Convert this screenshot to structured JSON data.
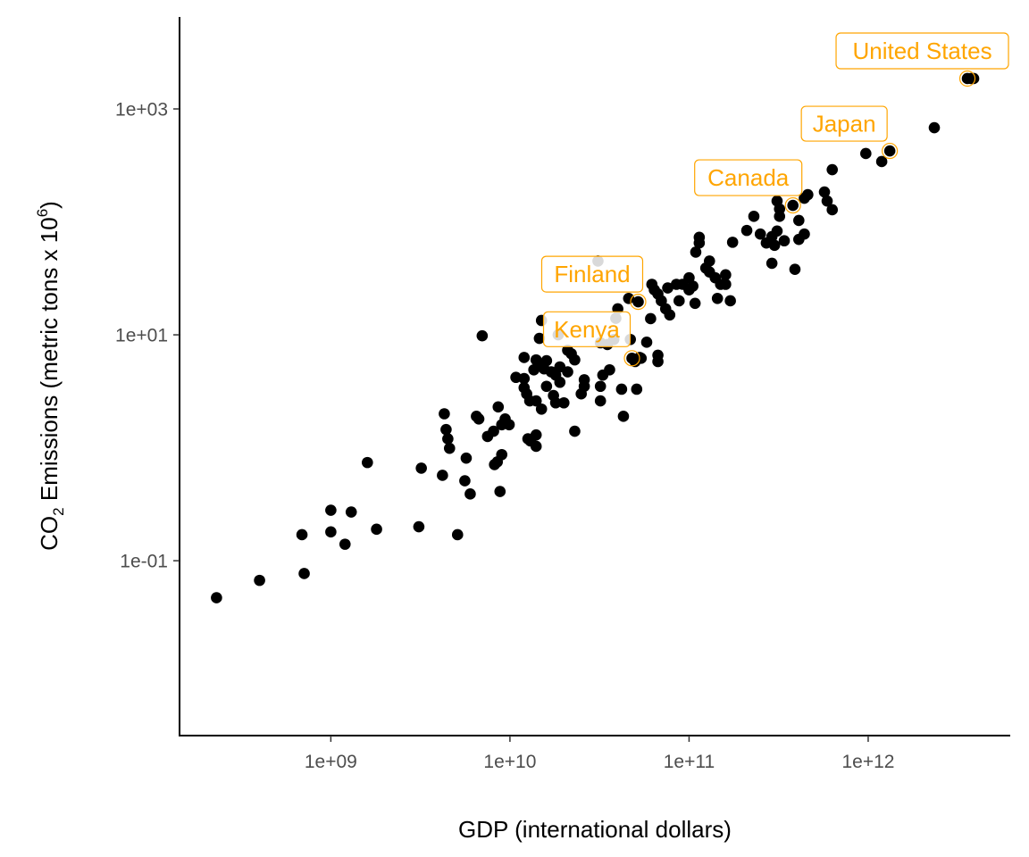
{
  "chart_data": {
    "type": "scatter",
    "title": "",
    "xlabel": "GDP (international dollars)",
    "ylabel": {
      "prefix": "CO",
      "subscript": "2",
      "middle": " Emissions (metric tons x 10",
      "superscript": "6",
      "suffix": ")"
    },
    "x_scale": "log10",
    "y_scale": "log10",
    "xlim": [
      143000000.0,
      6210000000000.0
    ],
    "ylim": [
      0.00283,
      6520
    ],
    "x_ticks": [
      {
        "value": 1000000000.0,
        "label": "1e+09"
      },
      {
        "value": 10000000000.0,
        "label": "1e+10"
      },
      {
        "value": 100000000000.0,
        "label": "1e+11"
      },
      {
        "value": 1000000000000.0,
        "label": "1e+12"
      }
    ],
    "y_ticks": [
      {
        "value": 0.1,
        "label": "1e-01"
      },
      {
        "value": 10,
        "label": "1e+01"
      },
      {
        "value": 1000,
        "label": "1e+03"
      }
    ],
    "grid": false,
    "legend": "none",
    "point_color": "#000000",
    "highlight_color": "#FFA500",
    "points": [
      [
        230000000.0,
        0.047
      ],
      [
        400000000.0,
        0.067
      ],
      [
        690000000.0,
        0.17
      ],
      [
        710000000.0,
        0.077
      ],
      [
        1000000000.0,
        0.28
      ],
      [
        1000000000.0,
        0.18
      ],
      [
        1300000000.0,
        0.27
      ],
      [
        1200000000.0,
        0.14
      ],
      [
        1600000000.0,
        0.74
      ],
      [
        1800000000.0,
        0.19
      ],
      [
        3100000000.0,
        0.2
      ],
      [
        3200000000.0,
        0.66
      ],
      [
        4200000000.0,
        0.57
      ],
      [
        4300000000.0,
        2.0
      ],
      [
        4400000000.0,
        1.45
      ],
      [
        4500000000.0,
        1.2
      ],
      [
        4600000000.0,
        0.99
      ],
      [
        5100000000.0,
        0.17
      ],
      [
        5600000000.0,
        0.51
      ],
      [
        6000000000.0,
        0.39
      ],
      [
        5700000000.0,
        0.81
      ],
      [
        6500000000.0,
        1.9
      ],
      [
        6700000000.0,
        1.8
      ],
      [
        7000000000.0,
        9.8
      ],
      [
        7500000000.0,
        1.26
      ],
      [
        8100000000.0,
        1.4
      ],
      [
        8200000000.0,
        0.71
      ],
      [
        8500000000.0,
        0.75
      ],
      [
        8800000000.0,
        0.41
      ],
      [
        8600000000.0,
        2.3
      ],
      [
        9000000000.0,
        1.6
      ],
      [
        9400000000.0,
        1.8
      ],
      [
        9900000000.0,
        1.6
      ],
      [
        9000000000.0,
        0.87
      ],
      [
        10800000000.0,
        4.2
      ],
      [
        12000000000.0,
        6.3
      ],
      [
        12000000000.0,
        4.1
      ],
      [
        12000000000.0,
        3.4
      ],
      [
        12400000000.0,
        3.0
      ],
      [
        12900000000.0,
        2.6
      ],
      [
        12600000000.0,
        1.2
      ],
      [
        13000000000.0,
        1.15
      ],
      [
        14000000000.0,
        1.03
      ],
      [
        14000000000.0,
        1.3
      ],
      [
        14000000000.0,
        2.6
      ],
      [
        15000000000.0,
        2.2
      ],
      [
        13600000000.0,
        4.9
      ],
      [
        14000000000.0,
        6.0
      ],
      [
        14600000000.0,
        5.3
      ],
      [
        14600000000.0,
        9.3
      ],
      [
        15500000000.0,
        5.0
      ],
      [
        16000000000.0,
        5.9
      ],
      [
        15000000000.0,
        13.4
      ],
      [
        17000000000.0,
        4.7
      ],
      [
        16000000000.0,
        3.5
      ],
      [
        18000000000.0,
        4.4
      ],
      [
        19000000000.0,
        3.8
      ],
      [
        17500000000.0,
        2.9
      ],
      [
        18000000000.0,
        2.5
      ],
      [
        18600000000.0,
        10
      ],
      [
        20000000000.0,
        2.5
      ],
      [
        19000000000.0,
        5.2
      ],
      [
        21000000000.0,
        4.7
      ],
      [
        22000000000.0,
        6.8
      ],
      [
        23000000000.0,
        6.0
      ],
      [
        23000000000.0,
        1.4
      ],
      [
        25000000000.0,
        3.0
      ],
      [
        26000000000.0,
        3.5
      ],
      [
        26000000000.0,
        4.0
      ],
      [
        21000000000.0,
        7.3
      ],
      [
        31000000000.0,
        45
      ],
      [
        32000000000.0,
        8.5
      ],
      [
        32000000000.0,
        2.6
      ],
      [
        32000000000.0,
        3.5
      ],
      [
        33000000000.0,
        4.4
      ],
      [
        35000000000.0,
        8.2
      ],
      [
        36000000000.0,
        4.9
      ],
      [
        38000000000.0,
        9.1
      ],
      [
        40000000000.0,
        17
      ],
      [
        39000000000.0,
        14
      ],
      [
        42000000000.0,
        3.3
      ],
      [
        43000000000.0,
        1.9
      ],
      [
        47000000000.0,
        9.1
      ],
      [
        46000000000.0,
        21
      ],
      [
        50000000000.0,
        5.8
      ],
      [
        51000000000.0,
        3.3
      ],
      [
        53000000000.0,
        6.3
      ],
      [
        54000000000.0,
        6.2
      ],
      [
        58000000000.0,
        8.6
      ],
      [
        61000000000.0,
        13.9
      ],
      [
        62000000000.0,
        28
      ],
      [
        64000000000.0,
        25
      ],
      [
        67000000000.0,
        23
      ],
      [
        70000000000.0,
        20
      ],
      [
        74000000000.0,
        17
      ],
      [
        78000000000.0,
        15
      ],
      [
        67000000000.0,
        6.6
      ],
      [
        67000000000.0,
        5.8
      ],
      [
        76000000000.0,
        26
      ],
      [
        85000000000.0,
        28
      ],
      [
        92000000000.0,
        28
      ],
      [
        100000000000.0,
        32
      ],
      [
        100000000000.0,
        25
      ],
      [
        105000000000.0,
        27
      ],
      [
        108000000000.0,
        19
      ],
      [
        88000000000.0,
        20
      ],
      [
        114000000000.0,
        73
      ],
      [
        114000000000.0,
        65
      ],
      [
        109000000000.0,
        54
      ],
      [
        130000000000.0,
        45
      ],
      [
        124000000000.0,
        39
      ],
      [
        130000000000.0,
        36
      ],
      [
        140000000000.0,
        32
      ],
      [
        150000000000.0,
        28
      ],
      [
        160000000000.0,
        28
      ],
      [
        160000000000.0,
        34
      ],
      [
        144000000000.0,
        21
      ],
      [
        170000000000.0,
        20
      ],
      [
        175000000000.0,
        66
      ],
      [
        210000000000.0,
        84
      ],
      [
        230000000000.0,
        112
      ],
      [
        250000000000.0,
        78
      ],
      [
        270000000000.0,
        65
      ],
      [
        290000000000.0,
        74
      ],
      [
        310000000000.0,
        83
      ],
      [
        300000000000.0,
        62
      ],
      [
        290000000000.0,
        43
      ],
      [
        310000000000.0,
        153
      ],
      [
        320000000000.0,
        130
      ],
      [
        320000000000.0,
        112
      ],
      [
        340000000000.0,
        68
      ],
      [
        410000000000.0,
        103
      ],
      [
        390000000000.0,
        38
      ],
      [
        410000000000.0,
        70
      ],
      [
        440000000000.0,
        78
      ],
      [
        440000000000.0,
        162
      ],
      [
        460000000000.0,
        174
      ],
      [
        570000000000.0,
        184
      ],
      [
        590000000000.0,
        153
      ],
      [
        630000000000.0,
        128
      ],
      [
        630000000000.0,
        290
      ],
      [
        970000000000.0,
        403
      ],
      [
        1190000000000.0,
        342
      ],
      [
        2340000000000.0,
        682
      ],
      [
        3750000000000.0,
        1858
      ],
      [
        3880000000000.0,
        1858
      ]
    ],
    "highlighted": [
      {
        "name": "United States",
        "gdp": 3580000000000.0,
        "co2": 1858
      },
      {
        "name": "Japan",
        "gdp": 1320000000000.0,
        "co2": 425
      },
      {
        "name": "Canada",
        "gdp": 380000000000.0,
        "co2": 140
      },
      {
        "name": "Finland",
        "gdp": 52000000000.0,
        "co2": 19.6
      },
      {
        "name": "Kenya",
        "gdp": 48000000000.0,
        "co2": 6.2
      }
    ]
  }
}
